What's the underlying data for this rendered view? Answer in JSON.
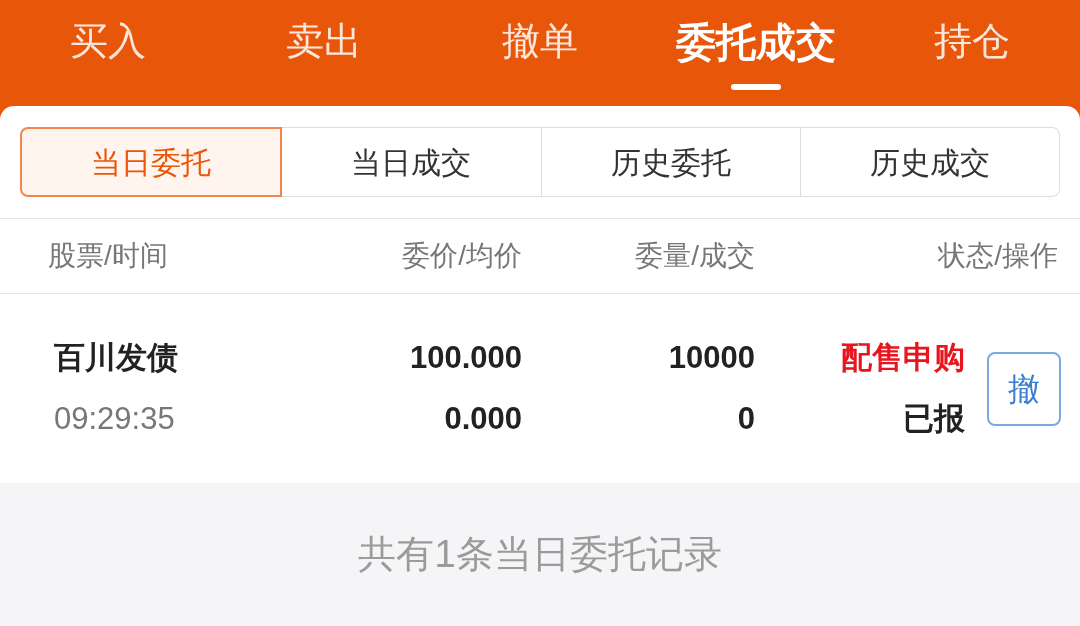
{
  "top_tabs": [
    {
      "label": "买入",
      "selected": false
    },
    {
      "label": "卖出",
      "selected": false
    },
    {
      "label": "撤单",
      "selected": false
    },
    {
      "label": "委托成交",
      "selected": true
    },
    {
      "label": "持仓",
      "selected": false
    }
  ],
  "sub_tabs": [
    {
      "label": "当日委托",
      "selected": true
    },
    {
      "label": "当日成交",
      "selected": false
    },
    {
      "label": "历史委托",
      "selected": false
    },
    {
      "label": "历史成交",
      "selected": false
    }
  ],
  "columns": [
    "股票/时间",
    "委价/均价",
    "委量/成交",
    "状态/操作"
  ],
  "orders": [
    {
      "stock": "百川发债",
      "time": "09:29:35",
      "order_price": "100.000",
      "avg_price": "0.000",
      "order_qty": "10000",
      "filled_qty": "0",
      "type": "配售申购",
      "status": "已报",
      "action": "撤"
    }
  ],
  "footer": "共有1条当日委托记录"
}
